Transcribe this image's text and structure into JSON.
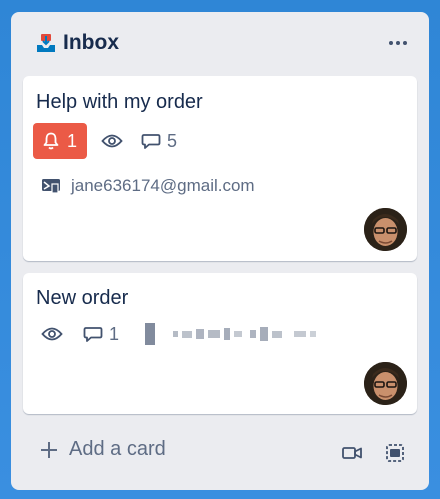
{
  "list": {
    "title": "Inbox",
    "more_icon": "more-horizontal-icon",
    "header_icon": "inbox-icon"
  },
  "cards": [
    {
      "title": "Help with my order",
      "alert_count": "1",
      "comment_count": "5",
      "email": "jane636174@gmail.com"
    },
    {
      "title": "New order",
      "comment_count": "1"
    }
  ],
  "footer": {
    "add_card_label": "Add a card"
  },
  "colors": {
    "alert": "#eb5a46",
    "list_bg": "#ebecf0",
    "page_bg": "#3a8fe0"
  }
}
